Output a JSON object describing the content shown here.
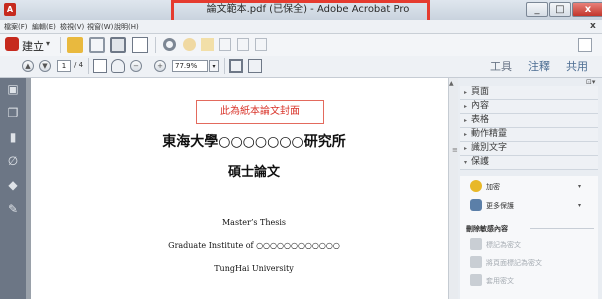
{
  "window": {
    "title": "論文範本.pdf (已保全) - Adobe Acrobat Pro",
    "minimize": "_",
    "maximize": "□",
    "close": "x",
    "doc_close": "x"
  },
  "menu": [
    "檔案(F)",
    "編輯(E)",
    "檢視(V)",
    "視窗(W)",
    "說明(H)"
  ],
  "toolbar": {
    "create_label": "建立",
    "create_caret": "▾"
  },
  "nav": {
    "page_current": "1",
    "page_total": "/ 4",
    "zoom": "77.9%",
    "zoom_caret": "▾"
  },
  "right_tabs": {
    "tools": "工具",
    "comment": "注釋",
    "share": "共用"
  },
  "document": {
    "cover_box": "此為紙本論文封面",
    "institute": "東海大學○○○○○○○研究所",
    "degree": "碩士論文",
    "thesis_en": "Master’s Thesis",
    "institute_en": "Graduate Institute of ○○○○○○○○○○○○",
    "university_en": "TungHai University"
  },
  "panel": {
    "menu_glyph": "⊡▾",
    "sections": [
      {
        "label": "頁面",
        "arrow": "▸"
      },
      {
        "label": "內容",
        "arrow": "▸"
      },
      {
        "label": "表格",
        "arrow": "▸"
      },
      {
        "label": "動作精靈",
        "arrow": "▸"
      },
      {
        "label": "識別文字",
        "arrow": "▸"
      },
      {
        "label": "保護",
        "arrow": "▾"
      }
    ],
    "protect_items": [
      {
        "label": "加密",
        "caret": "▾",
        "icon": "key-icon",
        "color": "#e8b828"
      },
      {
        "label": "更多保護",
        "caret": "▾",
        "icon": "shield-icon",
        "color": "#5b7fa8"
      }
    ],
    "remove_header": "刪除敏感內容",
    "remove_items": [
      {
        "label": "標記為密文",
        "icon": "mark-redaction-icon"
      },
      {
        "label": "將頁面標記為密文",
        "icon": "mark-page-redaction-icon"
      },
      {
        "label": "套用密文",
        "icon": "apply-redaction-icon"
      }
    ]
  },
  "colors": {
    "highlight": "#e53b2f",
    "cover_red": "#d9342a",
    "leftnav": "#6c7685"
  }
}
